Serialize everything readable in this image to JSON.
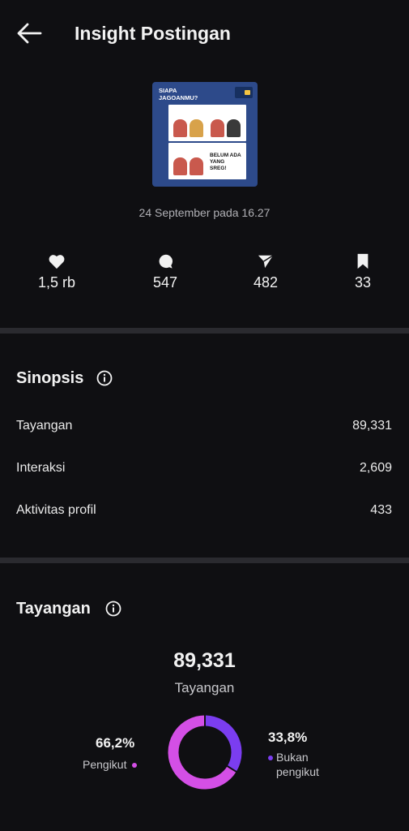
{
  "header": {
    "title": "Insight Postingan"
  },
  "post": {
    "thumbnail_heading": "SIAPA JAGOANMU?",
    "thumbnail_card_text": "BELUM ADA YANG SREG!",
    "date": "24 September pada 16.27"
  },
  "stats": {
    "likes": "1,5 rb",
    "comments": "547",
    "shares": "482",
    "saves": "33"
  },
  "sinopsis": {
    "title": "Sinopsis",
    "rows": [
      {
        "label": "Tayangan",
        "value": "89,331"
      },
      {
        "label": "Interaksi",
        "value": "2,609"
      },
      {
        "label": "Aktivitas profil",
        "value": "433"
      }
    ]
  },
  "tayangan": {
    "title": "Tayangan",
    "total": "89,331",
    "total_label": "Tayangan",
    "followers_pct": "66,2%",
    "followers_label": "Pengikut",
    "nonfollowers_pct": "33,8%",
    "nonfollowers_label_1": "Bukan",
    "nonfollowers_label_2": "pengikut"
  },
  "chart_data": {
    "type": "pie",
    "categories": [
      "Pengikut",
      "Bukan pengikut"
    ],
    "values": [
      66.2,
      33.8
    ]
  },
  "colors": {
    "followers": "#d44fe6",
    "nonfollowers": "#7b3df0",
    "background": "#0f0f12",
    "divider": "#2a2a2f"
  },
  "icons": {
    "back": "arrow-left-icon",
    "likes": "heart-icon",
    "comments": "comment-bubble-icon",
    "shares": "send-icon",
    "saves": "bookmark-icon",
    "info": "info-circle-icon"
  }
}
